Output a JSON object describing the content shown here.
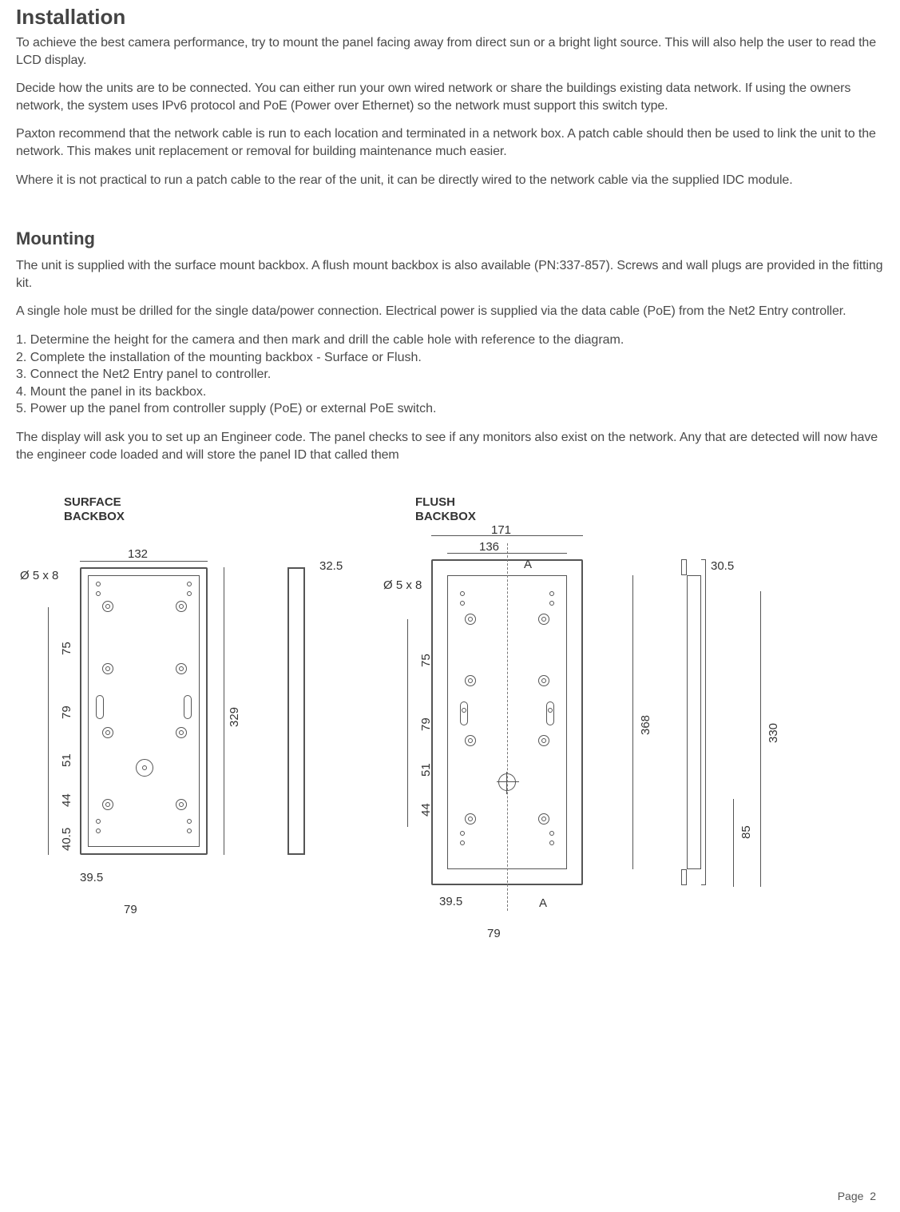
{
  "headings": {
    "installation": "Installation",
    "mounting": "Mounting"
  },
  "paragraphs": {
    "p1": "To achieve the best camera performance, try to mount the panel facing away from direct sun or a bright light source. This will also help the user to read the LCD display.",
    "p2": "Decide how the units are to be connected. You can either run your own wired network or share the buildings existing data network. If using the owners network, the system uses IPv6 protocol and PoE (Power over Ethernet) so the network must support this switch type.",
    "p3": "Paxton recommend that the network cable is run to each location and terminated in a network box.  A patch cable should then be used to link the unit to the network.  This makes unit replacement or removal for building maintenance much easier.",
    "p4": "Where it is not practical to run a patch cable to the rear of the unit, it can be directly wired to the network cable via the supplied IDC module.",
    "p5": "The unit is supplied with the surface mount backbox.  A flush mount backbox is also available (PN:337-857).  Screws and wall plugs are provided in the fitting kit.",
    "p6": "A single hole must be drilled for the single data/power connection. Electrical power is supplied via the data cable (PoE) from the Net2 Entry controller.",
    "p7": "The display will ask you to set up an Engineer code.  The panel checks to see if any monitors also exist on the network. Any that are detected will now have the engineer code loaded and will store the panel ID that called them"
  },
  "steps": {
    "s1": "1. Determine the height for the camera and then mark and drill the cable hole with reference to the diagram.",
    "s2": "2. Complete the installation of the mounting backbox - Surface or Flush.",
    "s3": "3. Connect the Net2 Entry panel to controller.",
    "s4": "4. Mount the panel in its backbox.",
    "s5": "5. Power up the panel from controller supply (PoE) or external PoE switch."
  },
  "diagram_titles": {
    "surface_line1": "SURFACE",
    "surface_line2": "BACKBOX",
    "flush_line1": "FLUSH",
    "flush_line2": "BACKBOX"
  },
  "dimensions": {
    "surface": {
      "screw_spec": "Ø 5   x 8",
      "width": "132",
      "depth": "32.5",
      "height": "329",
      "left_seg_top": "75",
      "left_seg_mid1": "79",
      "left_seg_mid2": "51",
      "left_seg_mid3": "44",
      "left_seg_bot": "40.5",
      "bottom_inner": "39.5",
      "bottom_center": "79"
    },
    "flush": {
      "screw_spec": "Ø 5   x 8",
      "outer_width": "171",
      "inner_width": "136",
      "arrow_label_top": "A",
      "arrow_label_bot": "A",
      "height": "368",
      "side_depth": "30.5",
      "side_full": "330",
      "side_inset": "85",
      "left_seg_top": "75",
      "left_seg_mid1": "79",
      "left_seg_mid2": "51",
      "left_seg_mid3": "44",
      "bottom_inner": "39.5",
      "bottom_center": "79"
    }
  },
  "footer": {
    "page_label": "Page",
    "page_num": "2"
  }
}
